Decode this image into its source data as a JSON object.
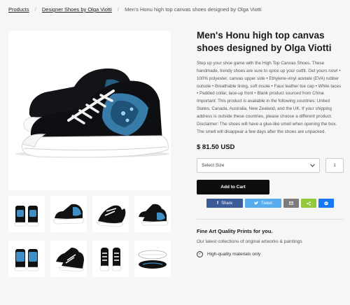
{
  "breadcrumb": {
    "items": [
      "Products",
      "Designer Shoes by Olga Viotti"
    ],
    "current": "Men's Honu high top canvas shoes designed by Olga Viotti"
  },
  "product": {
    "title": "Men's Honu high top canvas shoes designed by Olga Viotti",
    "description": "Step up your shoe game with the High Top Canvas Shoes. These handmade, trendy shoes are sure to spice up your outfit. Get yours now! • 100% polyester, canvas upper side • Ethylene-vinyl acetate (EVA) rubber outsole • Breathable lining, soft insole • Faux leather toe cap • White laces • Padded collar, lace-up front • Blank product sourced from China Important: This product is available in the following countries: United States, Canada, Australia, New Zealand, and the UK. If your shipping address is outside these countries, please choose a different product. Disclaimer: The shoes will have a glue-like smell when opening the box. The smell will disappear a few days after the shoes are unpacked.",
    "price": "$ 81.50 USD"
  },
  "options": {
    "size_placeholder": "Select Size",
    "quantity": "1"
  },
  "cart": {
    "label": "Add to Cart"
  },
  "share": {
    "facebook": "Share",
    "twitter": "Tweet",
    "email_icon": "envelope",
    "share_icon": "share",
    "messenger_icon": "messenger"
  },
  "promo": {
    "title": "Fine Art Quality Prints for you.",
    "subtitle": "Our latest collections of original artworks & paintings",
    "feature": "High-quality materials only"
  },
  "colors": {
    "shoe_body": "#0d0f12",
    "shoe_art": "#3f8fc4",
    "sole": "#ffffff",
    "facebook": "#3b5a98",
    "twitter": "#55acee",
    "email": "#7b7b7b",
    "sharethis": "#93c93d",
    "messenger": "#1877f2"
  },
  "thumbnails": [
    {
      "view": "back-pair"
    },
    {
      "view": "side-angle"
    },
    {
      "view": "top-angle"
    },
    {
      "view": "side-pair"
    },
    {
      "view": "back-low"
    },
    {
      "view": "front-angle"
    },
    {
      "view": "front-pair"
    },
    {
      "view": "sole-view"
    }
  ]
}
